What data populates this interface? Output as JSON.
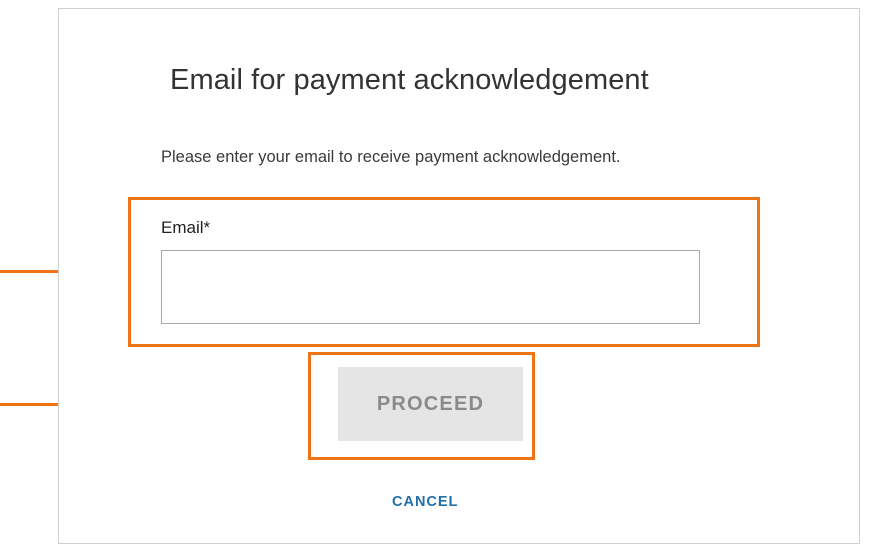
{
  "dialog": {
    "title": "Email for payment acknowledgement",
    "subtitle": "Please enter your email to receive payment acknowledgement.",
    "email_label": "Email*",
    "email_value": "",
    "proceed_label": "PROCEED",
    "proceed_enabled": false,
    "cancel_label": "CANCEL"
  },
  "colors": {
    "highlight": "#f07316",
    "proceed_disabled_bg": "#e5e5e5",
    "proceed_disabled_text": "#8a8a8a",
    "cancel_link": "#1f6fa8"
  }
}
